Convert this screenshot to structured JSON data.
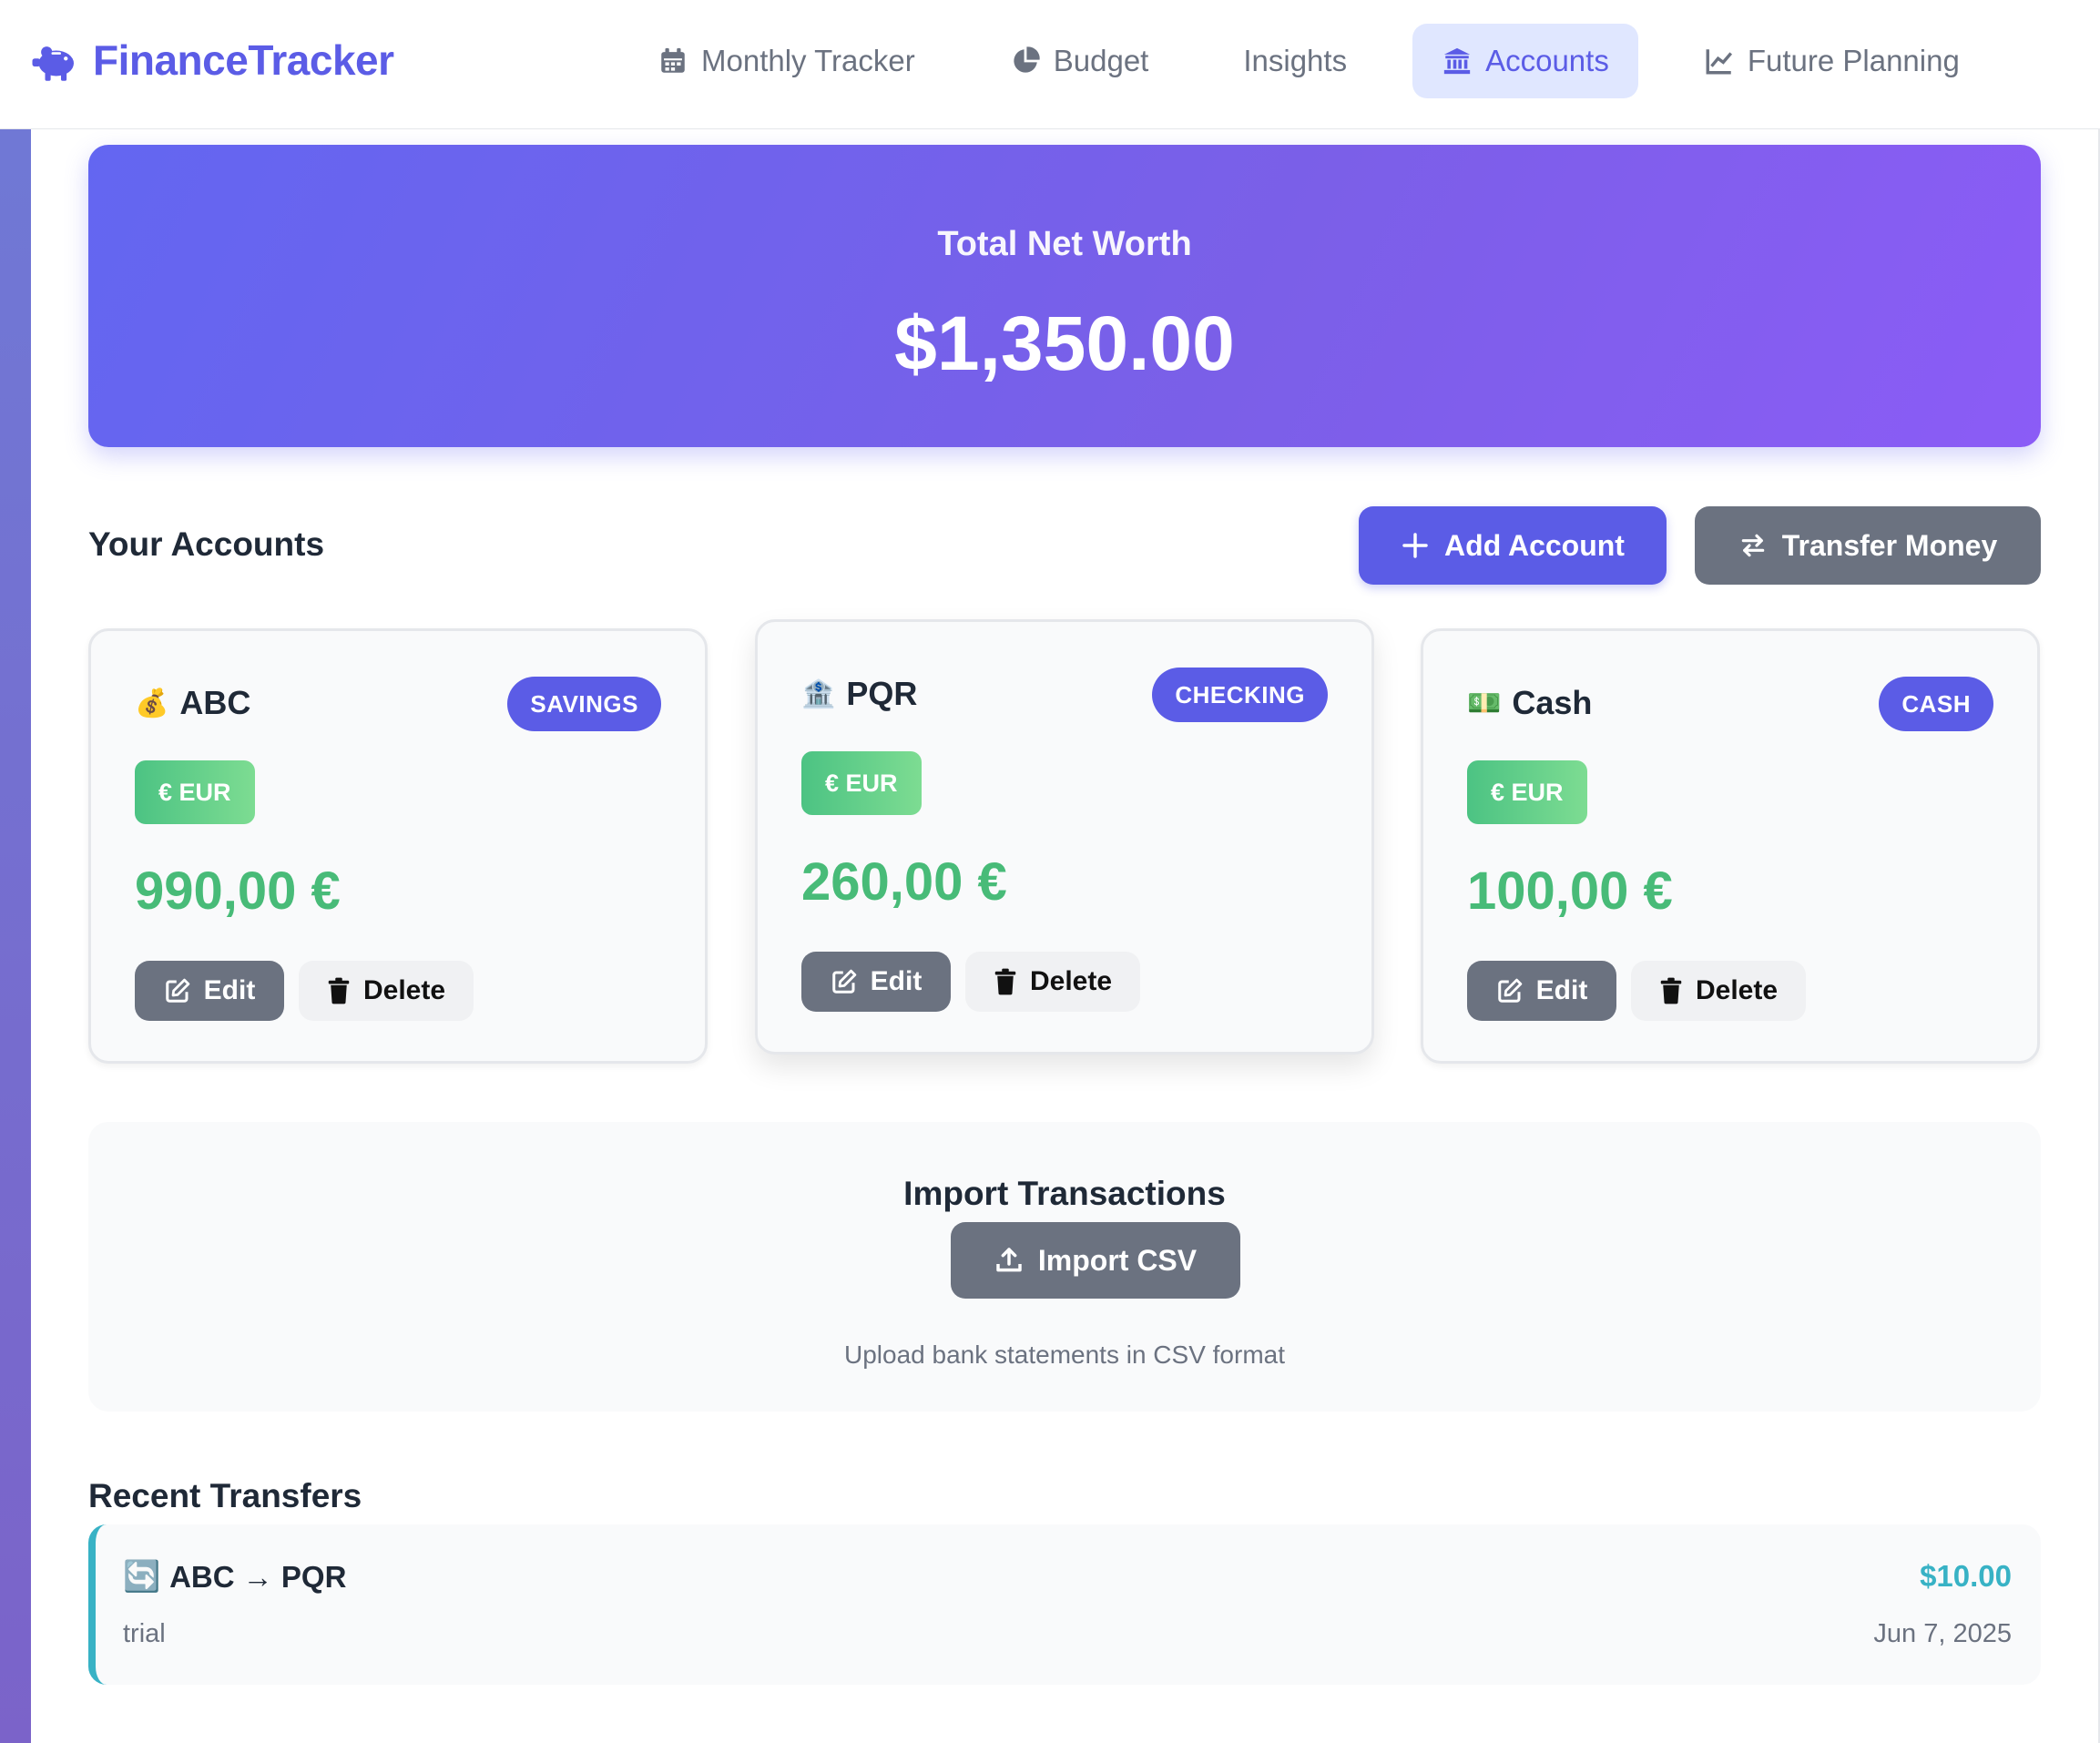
{
  "app": {
    "name": "FinanceTracker",
    "brand_color": "#5b5ce6"
  },
  "nav": {
    "items": [
      {
        "label": "Monthly Tracker",
        "icon": "calendar-icon",
        "active": false
      },
      {
        "label": "Budget",
        "icon": "pie-chart-icon",
        "active": false
      },
      {
        "label": "Insights",
        "icon": "none",
        "active": false
      },
      {
        "label": "Accounts",
        "icon": "bank-icon",
        "active": true
      },
      {
        "label": "Future Planning",
        "icon": "line-chart-icon",
        "active": false
      }
    ]
  },
  "net_worth": {
    "label": "Total Net Worth",
    "value": "$1,350.00"
  },
  "accounts_section": {
    "title": "Your Accounts",
    "add_button": "Add Account",
    "transfer_button": "Transfer Money"
  },
  "accounts": [
    {
      "emoji": "💰",
      "name": "ABC",
      "type": "SAVINGS",
      "currency": "€ EUR",
      "balance": "990,00 €",
      "edit": "Edit",
      "delete": "Delete"
    },
    {
      "emoji": "🏦",
      "name": "PQR",
      "type": "CHECKING",
      "currency": "€ EUR",
      "balance": "260,00 €",
      "edit": "Edit",
      "delete": "Delete"
    },
    {
      "emoji": "💵",
      "name": "Cash",
      "type": "CASH",
      "currency": "€ EUR",
      "balance": "100,00 €",
      "edit": "Edit",
      "delete": "Delete"
    }
  ],
  "import": {
    "title": "Import Transactions",
    "button": "Import CSV",
    "hint": "Upload bank statements in CSV format"
  },
  "recent_transfers": {
    "title": "Recent Transfers",
    "items": [
      {
        "icon": "🔄",
        "route": "ABC → PQR",
        "note": "trial",
        "amount": "$10.00",
        "date": "Jun 7, 2025"
      }
    ]
  },
  "colors": {
    "accent": "#5b5ce6",
    "positive": "#48bb78",
    "transfer": "#38b2c5",
    "neutral_button": "#6b7280"
  }
}
